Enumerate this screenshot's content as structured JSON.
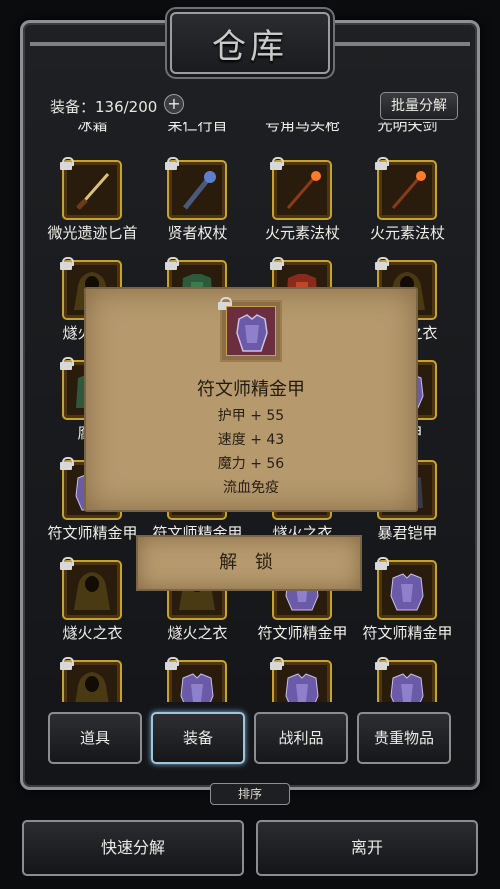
{
  "window": {
    "title": "仓库"
  },
  "top_bar": {
    "capacity_label": "装备：136/200",
    "plus": "+",
    "bulk_decompose": "批量分解"
  },
  "grid": {
    "partial_row_labels": [
      "冰霜",
      "呆仁行首",
      "号角马头枪",
      "光明矢剑"
    ],
    "items": [
      {
        "label": "微光遗迹匕首",
        "icon": "dagger-icon"
      },
      {
        "label": "贤者权杖",
        "icon": "scepter-icon"
      },
      {
        "label": "火元素法杖",
        "icon": "fire-staff-icon"
      },
      {
        "label": "火元素法杖",
        "icon": "fire-staff-icon"
      },
      {
        "label": "燧火之衣",
        "icon": "hooded-robe-icon"
      },
      {
        "label": "",
        "icon": "green-armor-icon"
      },
      {
        "label": "",
        "icon": "red-armor-icon"
      },
      {
        "label": "燧火之衣",
        "icon": "hooded-robe-icon"
      },
      {
        "label": "腐蚀",
        "icon": "green-armor-icon"
      },
      {
        "label": "",
        "icon": ""
      },
      {
        "label": "",
        "icon": ""
      },
      {
        "label": "鳞甲",
        "icon": "purple-armor-icon"
      },
      {
        "label": "符文师精金甲",
        "icon": "purple-armor-icon"
      },
      {
        "label": "符文师精金甲",
        "icon": "purple-armor-icon"
      },
      {
        "label": "燧火之衣",
        "icon": "hooded-robe-icon"
      },
      {
        "label": "暴君铠甲",
        "icon": "dark-armor-icon"
      },
      {
        "label": "燧火之衣",
        "icon": "hooded-robe-icon"
      },
      {
        "label": "燧火之衣",
        "icon": "hooded-robe-icon"
      },
      {
        "label": "符文师精金甲",
        "icon": "purple-armor-icon"
      },
      {
        "label": "符文师精金甲",
        "icon": "purple-armor-icon"
      },
      {
        "label": "",
        "icon": "hooded-robe-icon"
      },
      {
        "label": "",
        "icon": "purple-armor-icon"
      },
      {
        "label": "",
        "icon": "purple-armor-icon"
      },
      {
        "label": "",
        "icon": "purple-armor-icon"
      }
    ]
  },
  "popup": {
    "item_name": "符文师精金甲",
    "icon": "purple-armor-icon",
    "stats": [
      "护甲 + 55",
      "速度 + 43",
      "魔力 + 56",
      "流血免疫"
    ],
    "unlock": "解 锁"
  },
  "tabs": [
    {
      "label": "道具",
      "active": false
    },
    {
      "label": "装备",
      "active": true
    },
    {
      "label": "战利品",
      "active": false
    },
    {
      "label": "贵重物品",
      "active": false
    }
  ],
  "sort_label": "排序",
  "bottom": {
    "quick_decompose": "快速分解",
    "leave": "离开"
  },
  "colors": {
    "slot_border": "#c8a22a",
    "parchment": "#b69a6e",
    "active_tab_glow": "#7fb3d4"
  }
}
